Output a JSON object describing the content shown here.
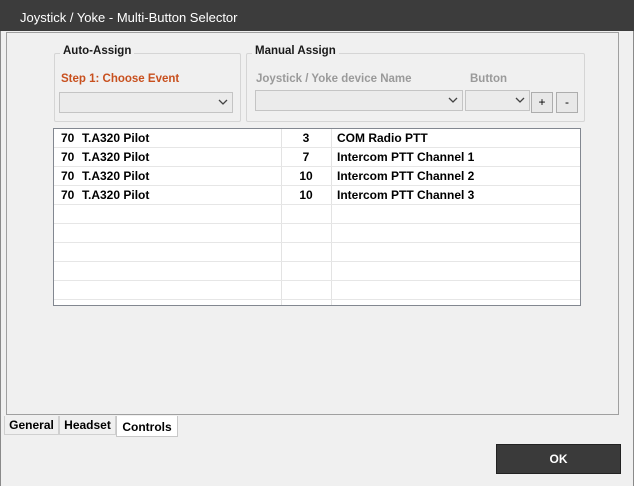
{
  "window": {
    "title": "Joystick / Yoke - Multi-Button Selector"
  },
  "auto_assign": {
    "group_title": "Auto-Assign",
    "step_label": "Step 1: Choose Event",
    "event_value": ""
  },
  "manual_assign": {
    "group_title": "Manual Assign",
    "device_label": "Joystick / Yoke device Name",
    "button_label": "Button",
    "device_value": "",
    "button_value": "",
    "plus_label": "+",
    "minus_label": "-"
  },
  "assignments": [
    {
      "id": "70",
      "name": "T.A320 Pilot",
      "button": "3",
      "event": "COM Radio PTT"
    },
    {
      "id": "70",
      "name": "T.A320 Pilot",
      "button": "7",
      "event": "Intercom PTT Channel 1"
    },
    {
      "id": "70",
      "name": "T.A320 Pilot",
      "button": "10",
      "event": "Intercom PTT Channel 2"
    },
    {
      "id": "70",
      "name": "T.A320 Pilot",
      "button": "10",
      "event": "Intercom PTT Channel 3"
    }
  ],
  "tabs": [
    {
      "label": "General",
      "active": false
    },
    {
      "label": "Headset",
      "active": false
    },
    {
      "label": "Controls",
      "active": true
    }
  ],
  "ok_label": "OK",
  "colors": {
    "titlebar": "#3c3c3c",
    "step_accent": "#c8501e",
    "ok_button": "#3a3a3a"
  },
  "icons": {
    "combo_arrow": "chevron-down-icon"
  }
}
